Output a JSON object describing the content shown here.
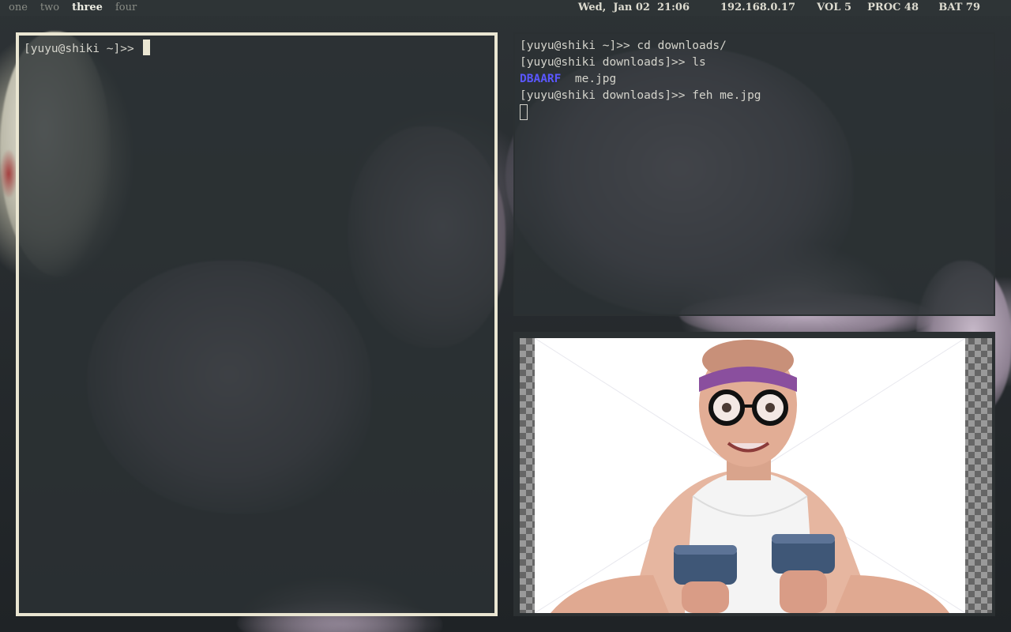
{
  "workspaces": [
    {
      "label": "one"
    },
    {
      "label": "two"
    },
    {
      "label": "three"
    },
    {
      "label": "four"
    }
  ],
  "active_workspace": "three",
  "status": {
    "date": "Wed,  Jan 02  21:06",
    "ip": "192.168.0.17",
    "vol": "VOL 5",
    "proc": "PROC 48",
    "bat": "BAT 79"
  },
  "terminal_left": {
    "prompt": "[yuyu@shiki ~]>> "
  },
  "terminal_right": {
    "line1": "[yuyu@shiki ~]>> cd downloads/",
    "line2": "[yuyu@shiki downloads]>> ls",
    "ls_dir": "DBAARF",
    "ls_file": "me.jpg",
    "line4": "[yuyu@shiki downloads]>> feh me.jpg"
  },
  "image_viewer": {
    "file": "me.jpg"
  },
  "colors": {
    "bar_bg": "#2e3436",
    "focused_border": "#eae6d2",
    "unfocused_border": "#2b3032",
    "dir_color": "#5a57ff"
  }
}
